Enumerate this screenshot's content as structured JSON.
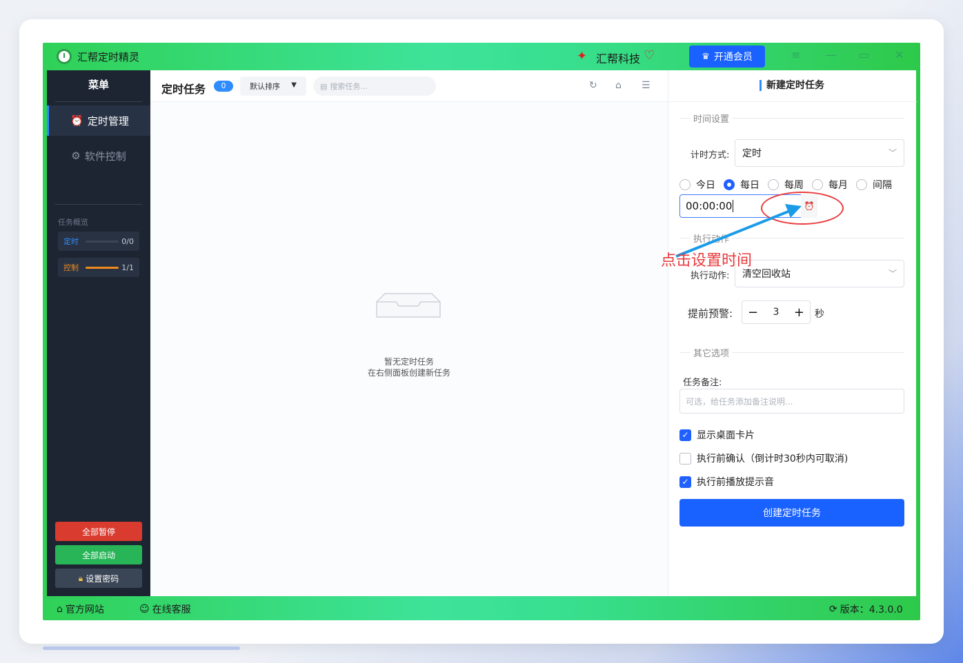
{
  "app": {
    "title": "汇帮定时精灵",
    "brand": "汇帮科技",
    "vip_label": "开通会员"
  },
  "sidebar": {
    "title": "菜单",
    "items": [
      {
        "label": "定时管理",
        "icon": "clock-icon",
        "active": true
      },
      {
        "label": "软件控制",
        "icon": "gear-icon",
        "active": false
      }
    ],
    "overview_label": "任务概览",
    "overview": [
      {
        "name": "定时",
        "value": "0/0",
        "progress": 0,
        "color": "#2f8cff"
      },
      {
        "name": "控制",
        "value": "1/1",
        "progress": 1,
        "color": "#f08a1e"
      }
    ],
    "buttons": {
      "pause_all": "全部暂停",
      "start_all": "全部启动",
      "set_password": "设置密码"
    }
  },
  "main": {
    "title": "定时任务",
    "count": "0",
    "sort": "默认排序",
    "search_placeholder": "搜索任务...",
    "empty_line1": "暂无定时任务",
    "empty_line2": "在右侧面板创建新任务"
  },
  "panel": {
    "title": "新建定时任务",
    "time_section": "时间设置",
    "timing_mode_label": "计时方式:",
    "timing_mode_value": "定时",
    "repeat_options": [
      {
        "label": "今日",
        "selected": false
      },
      {
        "label": "每日",
        "selected": true
      },
      {
        "label": "每周",
        "selected": false
      },
      {
        "label": "每月",
        "selected": false
      },
      {
        "label": "间隔",
        "selected": false
      }
    ],
    "time_value": "00:00:00",
    "action_section": "执行动作",
    "action_label": "执行动作:",
    "action_value": "清空回收站",
    "warning_label": "提前预警:",
    "warning_value": "3",
    "warning_unit": "秒",
    "other_section": "其它选项",
    "note_label": "任务备注:",
    "note_placeholder": "可选，给任务添加备注说明...",
    "checks": [
      {
        "label": "显示桌面卡片",
        "checked": true
      },
      {
        "label": "执行前确认（倒计时30秒内可取消)",
        "checked": false
      },
      {
        "label": "执行前播放提示音",
        "checked": true
      }
    ],
    "create_button": "创建定时任务"
  },
  "bottom": {
    "website": "官方网站",
    "support": "在线客服",
    "version": "版本：4.3.0.0"
  },
  "annotation": {
    "text": "点击设置时间"
  }
}
